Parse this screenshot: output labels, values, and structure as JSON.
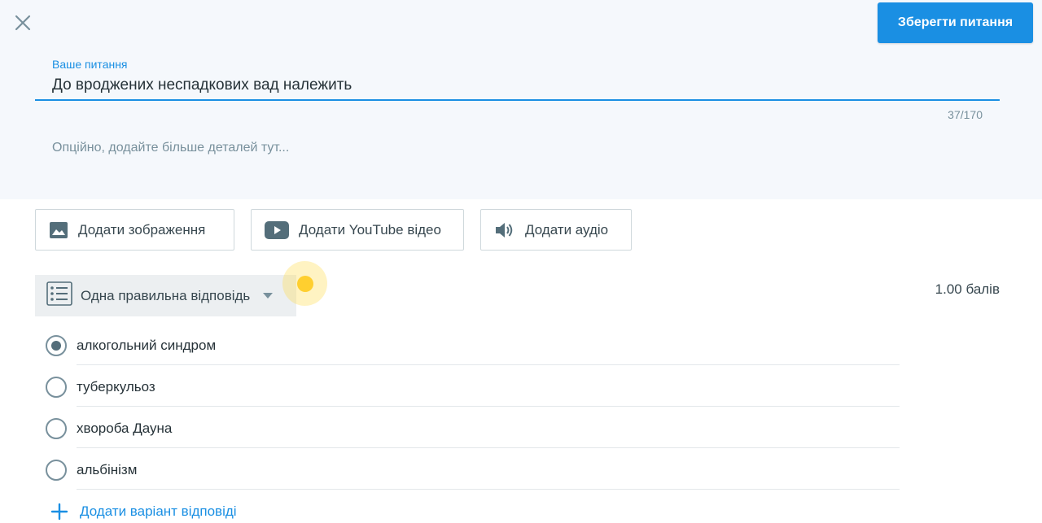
{
  "header": {
    "close_icon": "close-icon",
    "save_label": "Зберегти питання"
  },
  "question": {
    "label": "Ваше питання",
    "text": "До вроджених неспадкових вад належить",
    "counter": "37/170",
    "details_placeholder": "Опційно, додайте більше деталей тут..."
  },
  "media_buttons": {
    "image": {
      "label": "Додати зображення",
      "icon": "image-icon"
    },
    "youtube": {
      "label": "Додати YouTube відео",
      "icon": "youtube-icon"
    },
    "audio": {
      "label": "Додати аудіо",
      "icon": "speaker-icon"
    }
  },
  "answer_type": {
    "label": "Одна правильна відповідь",
    "icon": "list-icon"
  },
  "points": "1.00 балів",
  "options": [
    {
      "label": "алкогольний синдром",
      "selected": true
    },
    {
      "label": "туберкульоз",
      "selected": false
    },
    {
      "label": "хвороба Дауна",
      "selected": false
    },
    {
      "label": "альбінізм",
      "selected": false
    }
  ],
  "add_option_label": "Додати варіант відповіді",
  "colors": {
    "accent": "#1a8fe3",
    "panel_bg": "#f5f8fc",
    "cursor_highlight": "#ffcf2f"
  }
}
